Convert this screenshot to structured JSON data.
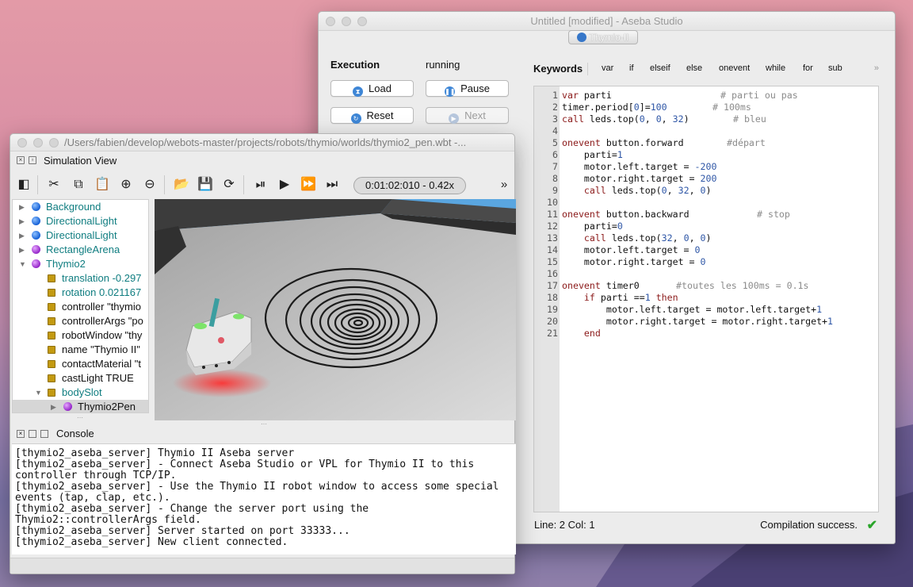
{
  "aseba": {
    "window_title": "Untitled [modified] - Aseba Studio",
    "robot_tab": "Thymio-II",
    "execution_label": "Execution",
    "execution_status": "running",
    "buttons": {
      "load": "Load",
      "pause": "Pause",
      "reset": "Reset",
      "next": "Next"
    },
    "keywords_title": "Keywords",
    "keywords": [
      "var",
      "if",
      "elseif",
      "else",
      "onevent",
      "while",
      "for",
      "sub"
    ],
    "more": "»",
    "line_numbers": [
      "1",
      "2",
      "3",
      "4",
      "5",
      "6",
      "7",
      "8",
      "9",
      "10",
      "11",
      "12",
      "13",
      "14",
      "15",
      "16",
      "17",
      "18",
      "19",
      "20",
      "21"
    ],
    "code_lines": [
      {
        "code": "var parti",
        "comment": "# parti ou pas"
      },
      {
        "code": "timer.period[0]=100",
        "comment": "# 100ms"
      },
      {
        "code": "call leds.top(0, 0, 32)",
        "comment": "# bleu"
      },
      {
        "code": "",
        "comment": ""
      },
      {
        "code": "onevent button.forward",
        "comment": "#départ"
      },
      {
        "code": "    parti=1",
        "comment": ""
      },
      {
        "code": "    motor.left.target = -200",
        "comment": ""
      },
      {
        "code": "    motor.right.target = 200",
        "comment": ""
      },
      {
        "code": "    call leds.top(0, 32, 0)",
        "comment": ""
      },
      {
        "code": "",
        "comment": ""
      },
      {
        "code": "onevent button.backward",
        "comment": "# stop"
      },
      {
        "code": "    parti=0",
        "comment": ""
      },
      {
        "code": "    call leds.top(32, 0, 0)",
        "comment": ""
      },
      {
        "code": "    motor.left.target = 0",
        "comment": ""
      },
      {
        "code": "    motor.right.target = 0",
        "comment": ""
      },
      {
        "code": "",
        "comment": ""
      },
      {
        "code": "onevent timer0",
        "comment": "#toutes les 100ms = 0.1s"
      },
      {
        "code": "    if parti ==1 then",
        "comment": ""
      },
      {
        "code": "        motor.left.target = motor.left.target+1",
        "comment": ""
      },
      {
        "code": "        motor.right.target = motor.right.target+1",
        "comment": ""
      },
      {
        "code": "    end",
        "comment": ""
      }
    ],
    "status_position": "Line: 2 Col: 1",
    "status_compile": "Compilation success."
  },
  "webots": {
    "window_title": "/Users/fabien/develop/webots-master/projects/robots/thymio/worlds/thymio2_pen.wbt -...",
    "panel_title": "Simulation View",
    "sim_time": "0:01:02:010  -  0.42x",
    "toolbar_more": "»",
    "tree": [
      {
        "label": "Background",
        "type": "blue",
        "depth": 0
      },
      {
        "label": "DirectionalLight",
        "type": "blue",
        "depth": 0
      },
      {
        "label": "DirectionalLight",
        "type": "blue",
        "depth": 0
      },
      {
        "label": "RectangleArena",
        "type": "purple",
        "depth": 0
      },
      {
        "label": "Thymio2",
        "type": "purple",
        "depth": 0,
        "open": true
      },
      {
        "label": "translation -0.297",
        "type": "field-teal",
        "depth": 1
      },
      {
        "label": "rotation 0.021167",
        "type": "field-teal",
        "depth": 1
      },
      {
        "label": "controller \"thymio",
        "type": "field",
        "depth": 1
      },
      {
        "label": "controllerArgs \"po",
        "type": "field",
        "depth": 1
      },
      {
        "label": "robotWindow \"thy",
        "type": "field",
        "depth": 1
      },
      {
        "label": "name \"Thymio II\"",
        "type": "field",
        "depth": 1
      },
      {
        "label": "contactMaterial \"t",
        "type": "field",
        "depth": 1
      },
      {
        "label": "castLight TRUE",
        "type": "field",
        "depth": 1
      },
      {
        "label": "bodySlot",
        "type": "field-teal",
        "depth": 1,
        "open": true
      },
      {
        "label": "Thymio2Pen",
        "type": "purple",
        "depth": 2,
        "selected": true
      }
    ],
    "console_title": "Console",
    "console_lines": [
      "[thymio2_aseba_server] Thymio II Aseba server",
      "[thymio2_aseba_server] - Connect Aseba Studio or VPL for Thymio II to this controller through TCP/IP.",
      "[thymio2_aseba_server] - Use the Thymio II robot window to access some special events (tap, clap, etc.).",
      "[thymio2_aseba_server] - Change the server port using the Thymio2::controllerArgs field.",
      "[thymio2_aseba_server] Server started on port 33333...",
      "[thymio2_aseba_server] New client connected."
    ]
  }
}
